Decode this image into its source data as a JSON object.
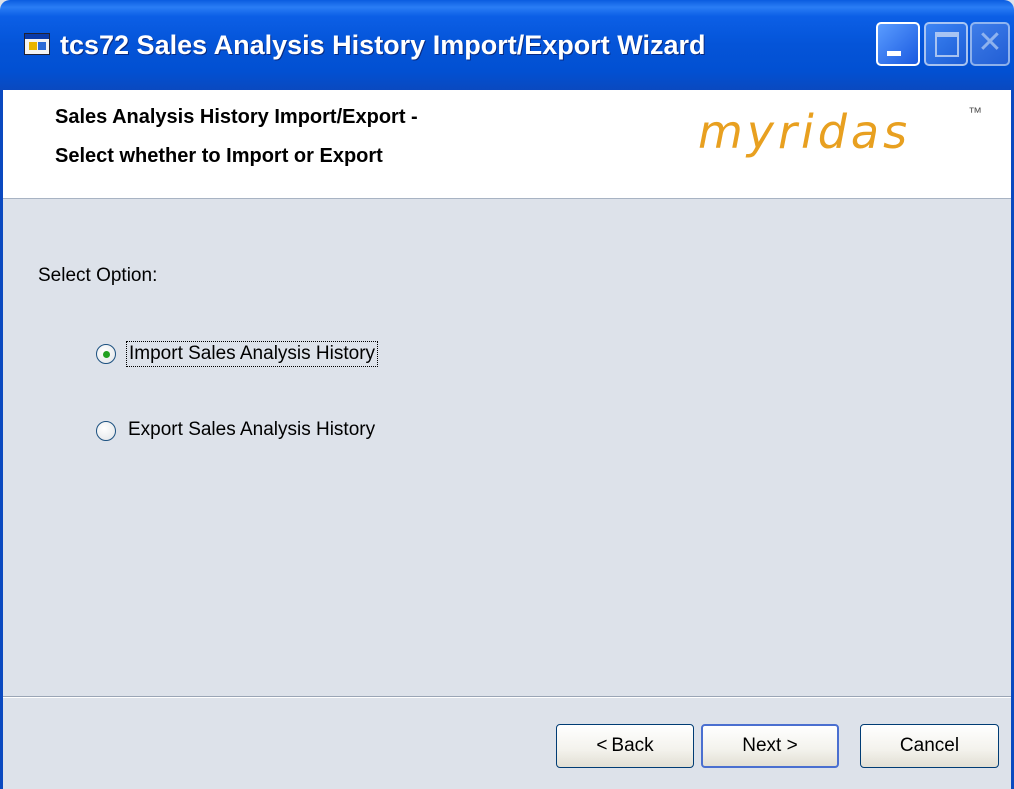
{
  "window": {
    "title": "tcs72 Sales Analysis History Import/Export Wizard",
    "minimize_icon": "minimize-icon",
    "maximize_icon": "maximize-icon",
    "close_glyph": "✕"
  },
  "header": {
    "line1": "Sales Analysis History Import/Export -",
    "line2": "Select whether to Import or Export",
    "logo_text": "myridas",
    "logo_tm": "™",
    "logo_color": "#e8a020"
  },
  "main": {
    "select_label": "Select Option:",
    "options": [
      {
        "label": "Import Sales Analysis History",
        "selected": true
      },
      {
        "label": "Export Sales Analysis History",
        "selected": false
      }
    ]
  },
  "buttons": {
    "back_arrow": "<",
    "back_label": "Back",
    "next_label": "Next >",
    "cancel_label": "Cancel"
  }
}
